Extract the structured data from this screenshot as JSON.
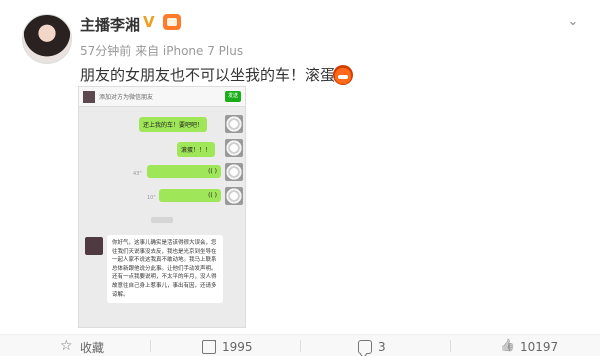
{
  "post": {
    "username": "主播李湘",
    "verified_mark": "V",
    "time_source": "57分钟前 来自 iPhone 7 Plus",
    "text": "朋友的女朋友也不可以坐我的车！滚蛋！",
    "emoji_icon": "angry-face-icon"
  },
  "screenshot": {
    "title": "添加对方为微信朋友",
    "send_label": "发送",
    "bubbles": [
      {
        "text": "还上我的车！要吧吧！"
      },
      {
        "text": "滚蛋！！！"
      },
      {
        "text": "(( )"
      },
      {
        "text": "(( )"
      }
    ],
    "voice_lengths": [
      "43\"",
      "10\""
    ],
    "left_message": "你好气，这事儿确实是活该得很大误会，您往我们天说事没去反，我也是光京到坐导在一起人家不说这我真不敢动地。我马上联系总体新跟他说分此事。让他们手动发声明。还有一点我要说明，不太平的年月，没人得故意往自己身上惹事儿，事出有因，还请多谅解。"
  },
  "actions": {
    "collect_label": "收藏",
    "repost_count": "1995",
    "comment_count": "3",
    "like_count": "10197"
  }
}
